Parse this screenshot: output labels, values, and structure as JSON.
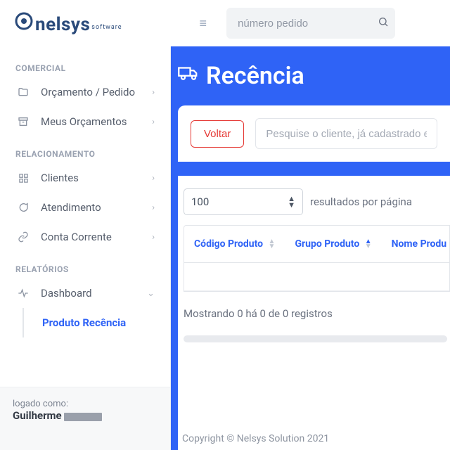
{
  "brand": {
    "name": "nelsys",
    "sub": "software"
  },
  "search": {
    "placeholder": "número pedido"
  },
  "sidebar": {
    "sections": [
      {
        "title": "COMERCIAL",
        "items": [
          {
            "label": "Orçamento / Pedido",
            "icon": "folder-icon"
          },
          {
            "label": "Meus Orçamentos",
            "icon": "archive-icon"
          }
        ]
      },
      {
        "title": "RELACIONAMENTO",
        "items": [
          {
            "label": "Clientes",
            "icon": "grid-icon"
          },
          {
            "label": "Atendimento",
            "icon": "chat-icon"
          },
          {
            "label": "Conta Corrente",
            "icon": "link-icon"
          }
        ]
      },
      {
        "title": "RELATÓRIOS",
        "items": [
          {
            "label": "Dashboard",
            "icon": "pulse-icon",
            "expanded": true,
            "children": [
              {
                "label": "Produto Recência",
                "active": true
              }
            ]
          }
        ]
      }
    ],
    "footer": {
      "prefix": "logado como:",
      "user": "Guilherme"
    }
  },
  "page": {
    "title": "Recência",
    "back_label": "Voltar",
    "client_search_placeholder": "Pesquise o cliente, já cadastrado ex.: I",
    "per_page_value": "100",
    "per_page_label": "resultados por página",
    "columns": [
      {
        "label": "Código Produto",
        "sort": "none"
      },
      {
        "label": "Grupo Produto",
        "sort": "asc"
      },
      {
        "label": "Nome Produ",
        "sort": "none"
      }
    ],
    "rows": [],
    "showing_text": "Mostrando 0 há 0 de 0 registros",
    "copyright": "Copyright © Nelsys Solution 2021"
  }
}
